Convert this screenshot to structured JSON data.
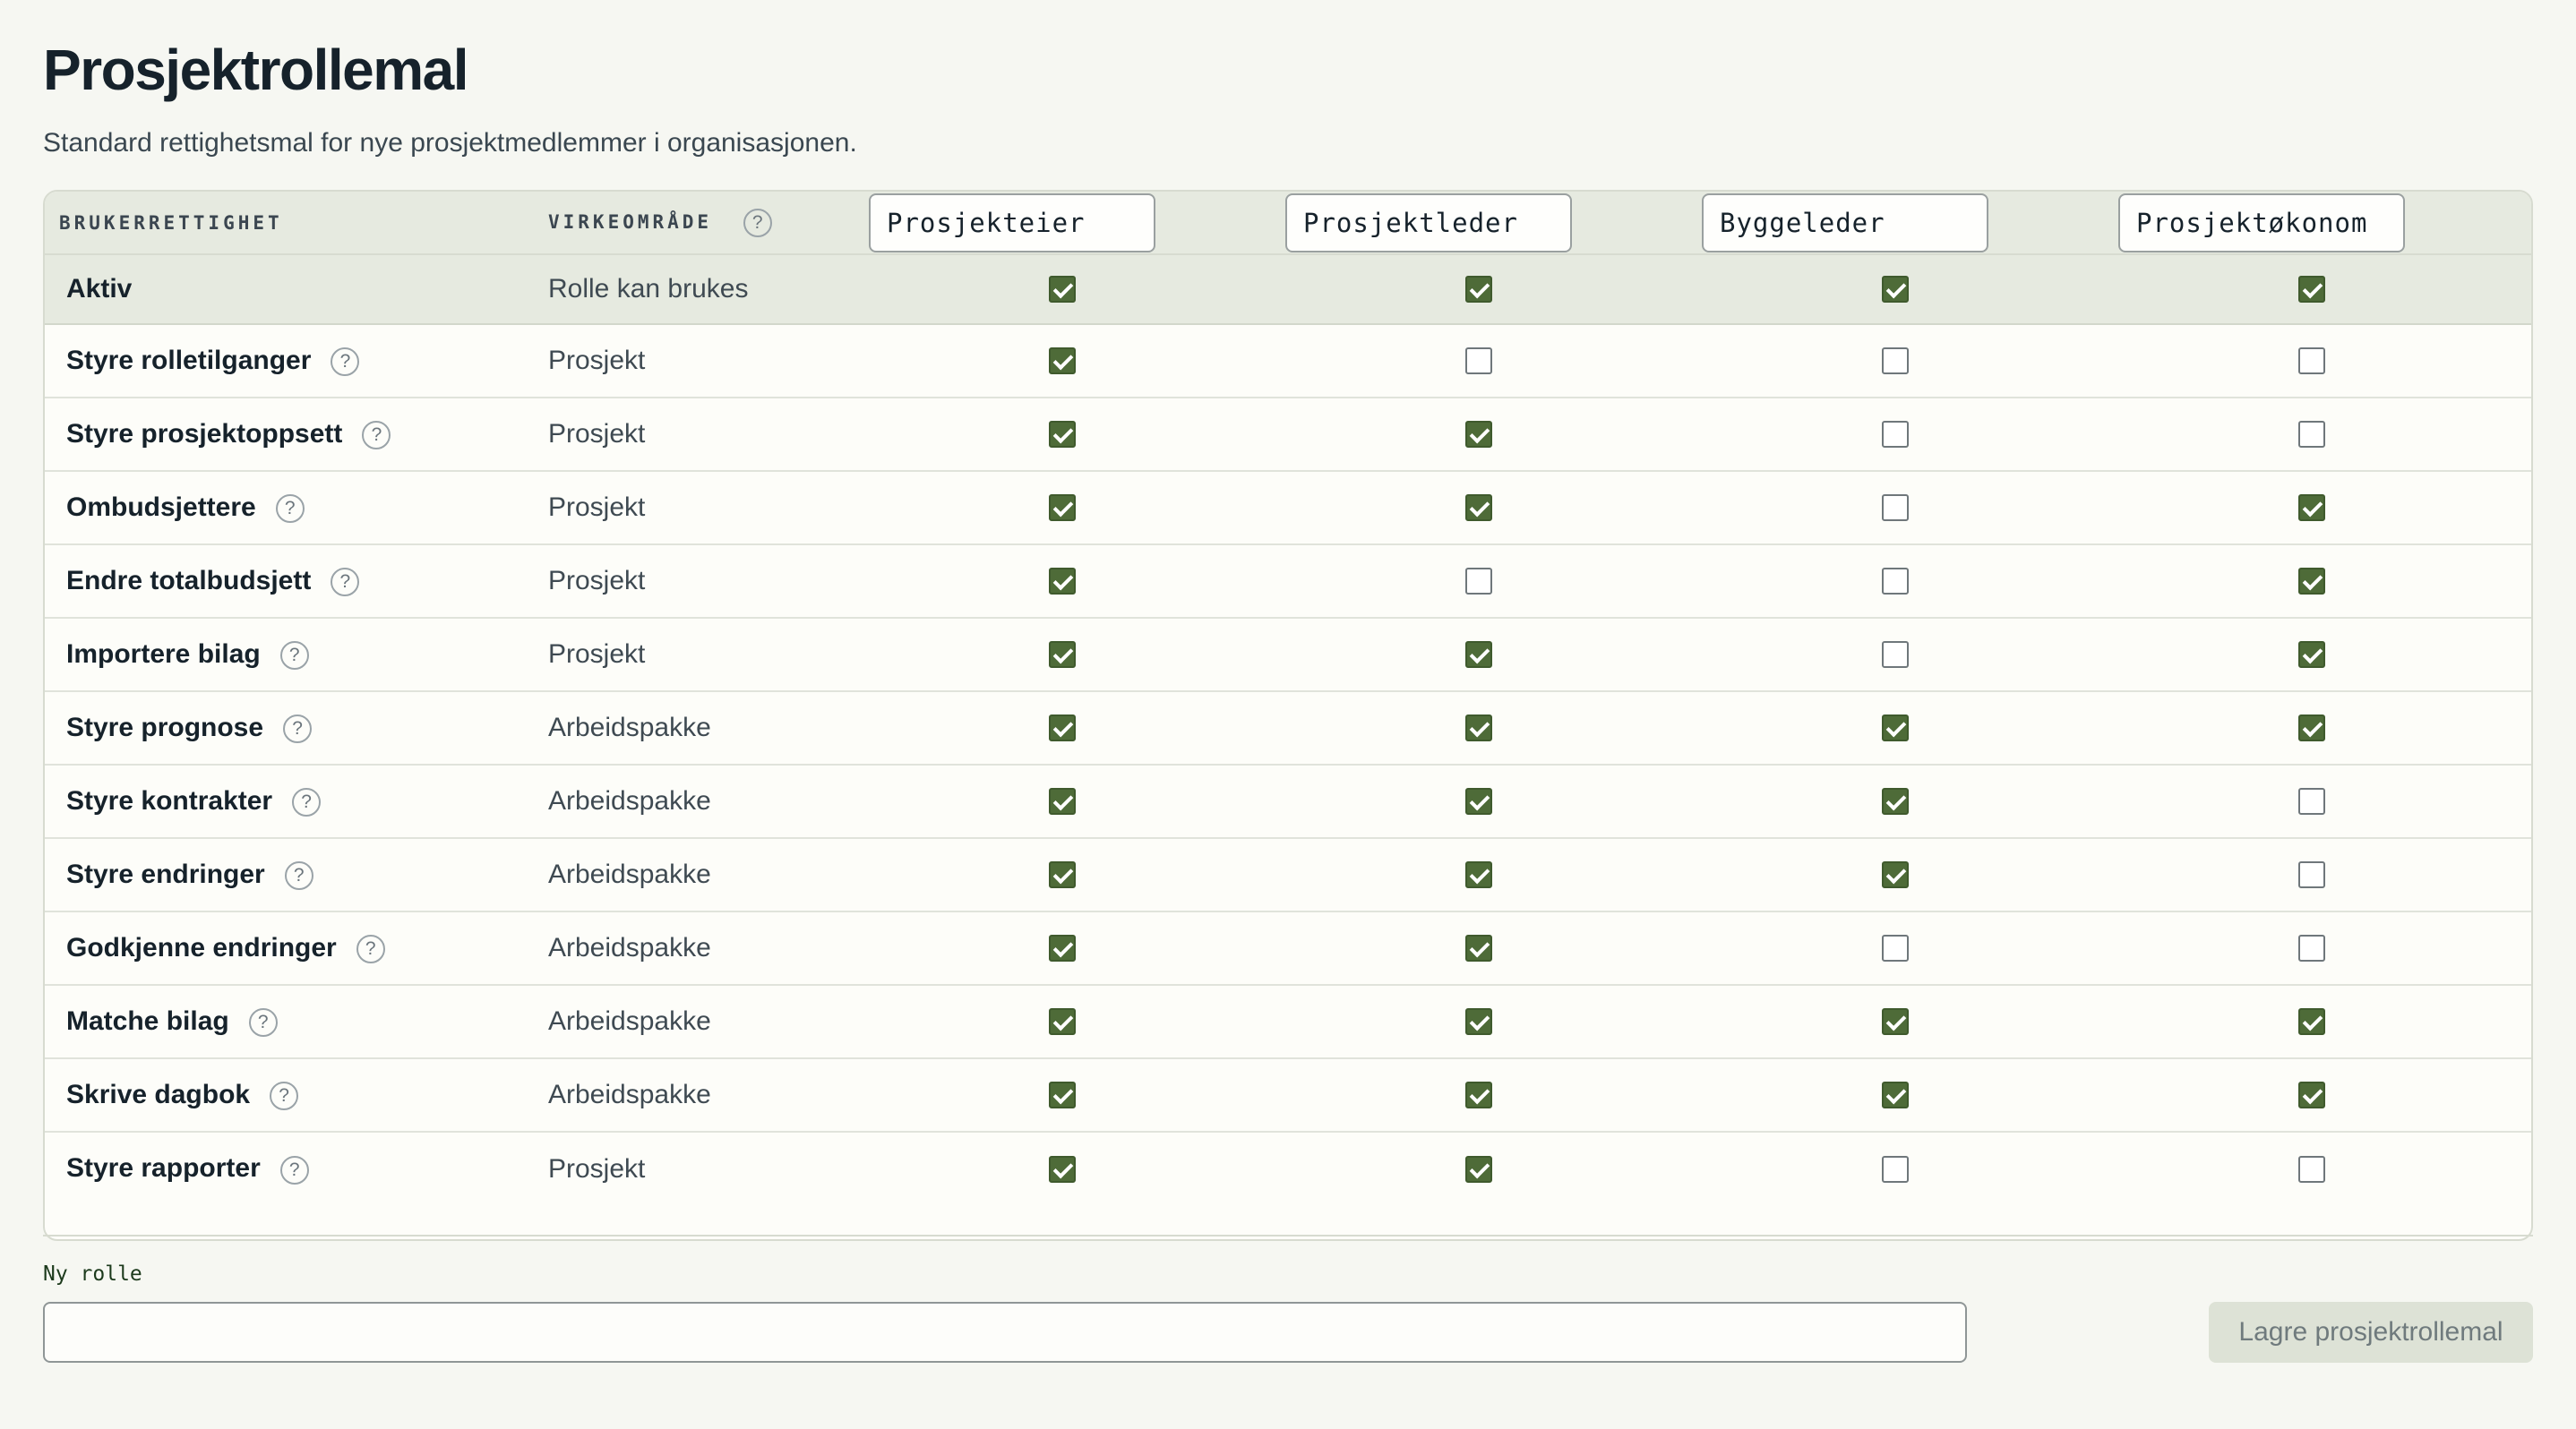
{
  "header": {
    "title": "Prosjektrollemal",
    "subtitle": "Standard rettighetsmal for nye prosjektmedlemmer i organisasjonen."
  },
  "table": {
    "columns": {
      "permission": "BRUKERRETTIGHET",
      "scope": "VIRKEOMRÅDE",
      "help_icon": "?"
    },
    "roles": [
      "Prosjekteier",
      "Prosjektleder",
      "Byggeleder",
      "Prosjektøkonom"
    ],
    "active_row": {
      "label": "Aktiv",
      "scope": "Rolle kan brukes",
      "values": [
        true,
        true,
        true,
        true
      ]
    },
    "rows": [
      {
        "label": "Styre rolletilganger",
        "scope": "Prosjekt",
        "values": [
          true,
          false,
          false,
          false
        ]
      },
      {
        "label": "Styre prosjektoppsett",
        "scope": "Prosjekt",
        "values": [
          true,
          true,
          false,
          false
        ]
      },
      {
        "label": "Ombudsjettere",
        "scope": "Prosjekt",
        "values": [
          true,
          true,
          false,
          true
        ]
      },
      {
        "label": "Endre totalbudsjett",
        "scope": "Prosjekt",
        "values": [
          true,
          false,
          false,
          true
        ]
      },
      {
        "label": "Importere bilag",
        "scope": "Prosjekt",
        "values": [
          true,
          true,
          false,
          true
        ]
      },
      {
        "label": "Styre prognose",
        "scope": "Arbeidspakke",
        "values": [
          true,
          true,
          true,
          true
        ]
      },
      {
        "label": "Styre kontrakter",
        "scope": "Arbeidspakke",
        "values": [
          true,
          true,
          true,
          false
        ]
      },
      {
        "label": "Styre endringer",
        "scope": "Arbeidspakke",
        "values": [
          true,
          true,
          true,
          false
        ]
      },
      {
        "label": "Godkjenne endringer",
        "scope": "Arbeidspakke",
        "values": [
          true,
          true,
          false,
          false
        ]
      },
      {
        "label": "Matche bilag",
        "scope": "Arbeidspakke",
        "values": [
          true,
          true,
          true,
          true
        ]
      },
      {
        "label": "Skrive dagbok",
        "scope": "Arbeidspakke",
        "values": [
          true,
          true,
          true,
          true
        ]
      },
      {
        "label": "Styre rapporter",
        "scope": "Prosjekt",
        "values": [
          true,
          true,
          false,
          false
        ]
      }
    ]
  },
  "footer": {
    "new_role_label": "Ny rolle",
    "new_role_value": "",
    "save_label": "Lagre prosjektrollemal"
  },
  "colors": {
    "checked": "#4e6b38",
    "header_bg": "#e6eae0",
    "page_bg": "#f6f7f2"
  }
}
